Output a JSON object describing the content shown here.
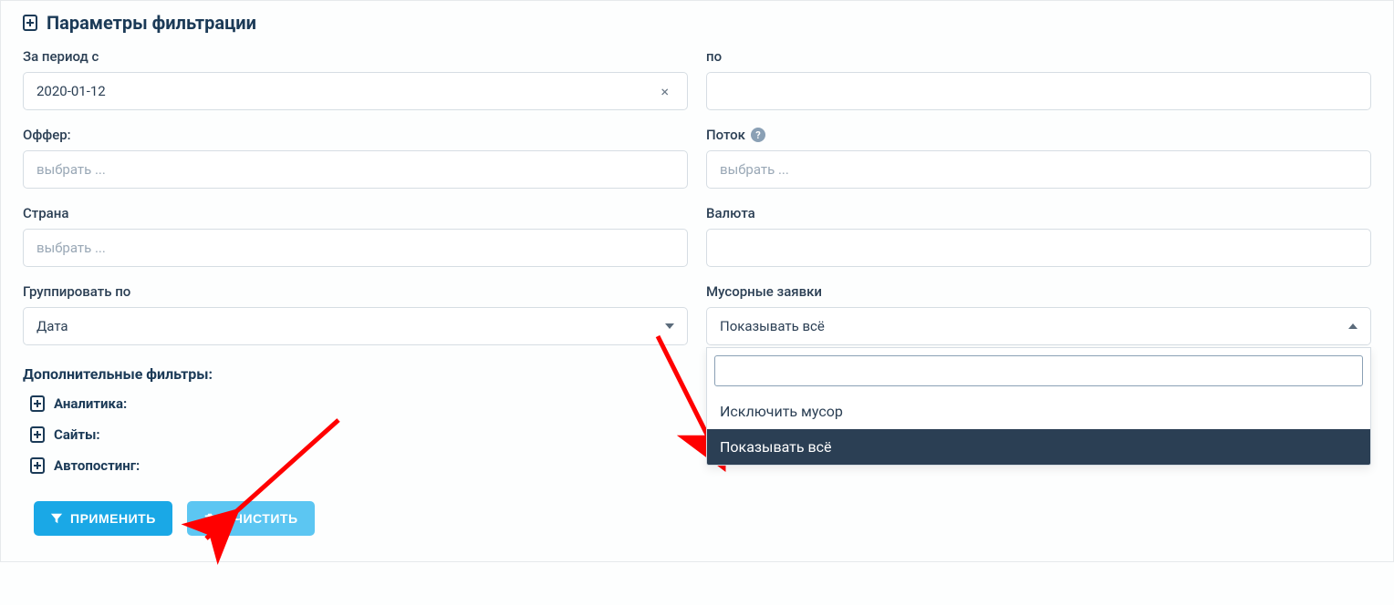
{
  "panel_title": "Параметры фильтрации",
  "fields": {
    "period_from": {
      "label": "За период с",
      "value": "2020-01-12"
    },
    "period_to": {
      "label": "по",
      "value": ""
    },
    "offer": {
      "label": "Оффер:",
      "placeholder": "выбрать ..."
    },
    "flow": {
      "label": "Поток",
      "placeholder": "выбрать ..."
    },
    "country": {
      "label": "Страна",
      "placeholder": "выбрать ..."
    },
    "currency": {
      "label": "Валюта",
      "value": ""
    },
    "group_by": {
      "label": "Группировать по",
      "value": "Дата"
    },
    "trash": {
      "label": "Мусорные заявки",
      "value": "Показывать всё"
    }
  },
  "trash_dropdown": {
    "search_value": "",
    "options": [
      {
        "label": "Исключить мусор",
        "selected": false
      },
      {
        "label": "Показывать всё",
        "selected": true
      }
    ]
  },
  "extra_filters_header": "Дополнительные фильтры:",
  "extra_filters": [
    "Аналитика:",
    "Сайты:",
    "Автопостинг:"
  ],
  "buttons": {
    "apply": "Применить",
    "clear": "Очистить"
  }
}
